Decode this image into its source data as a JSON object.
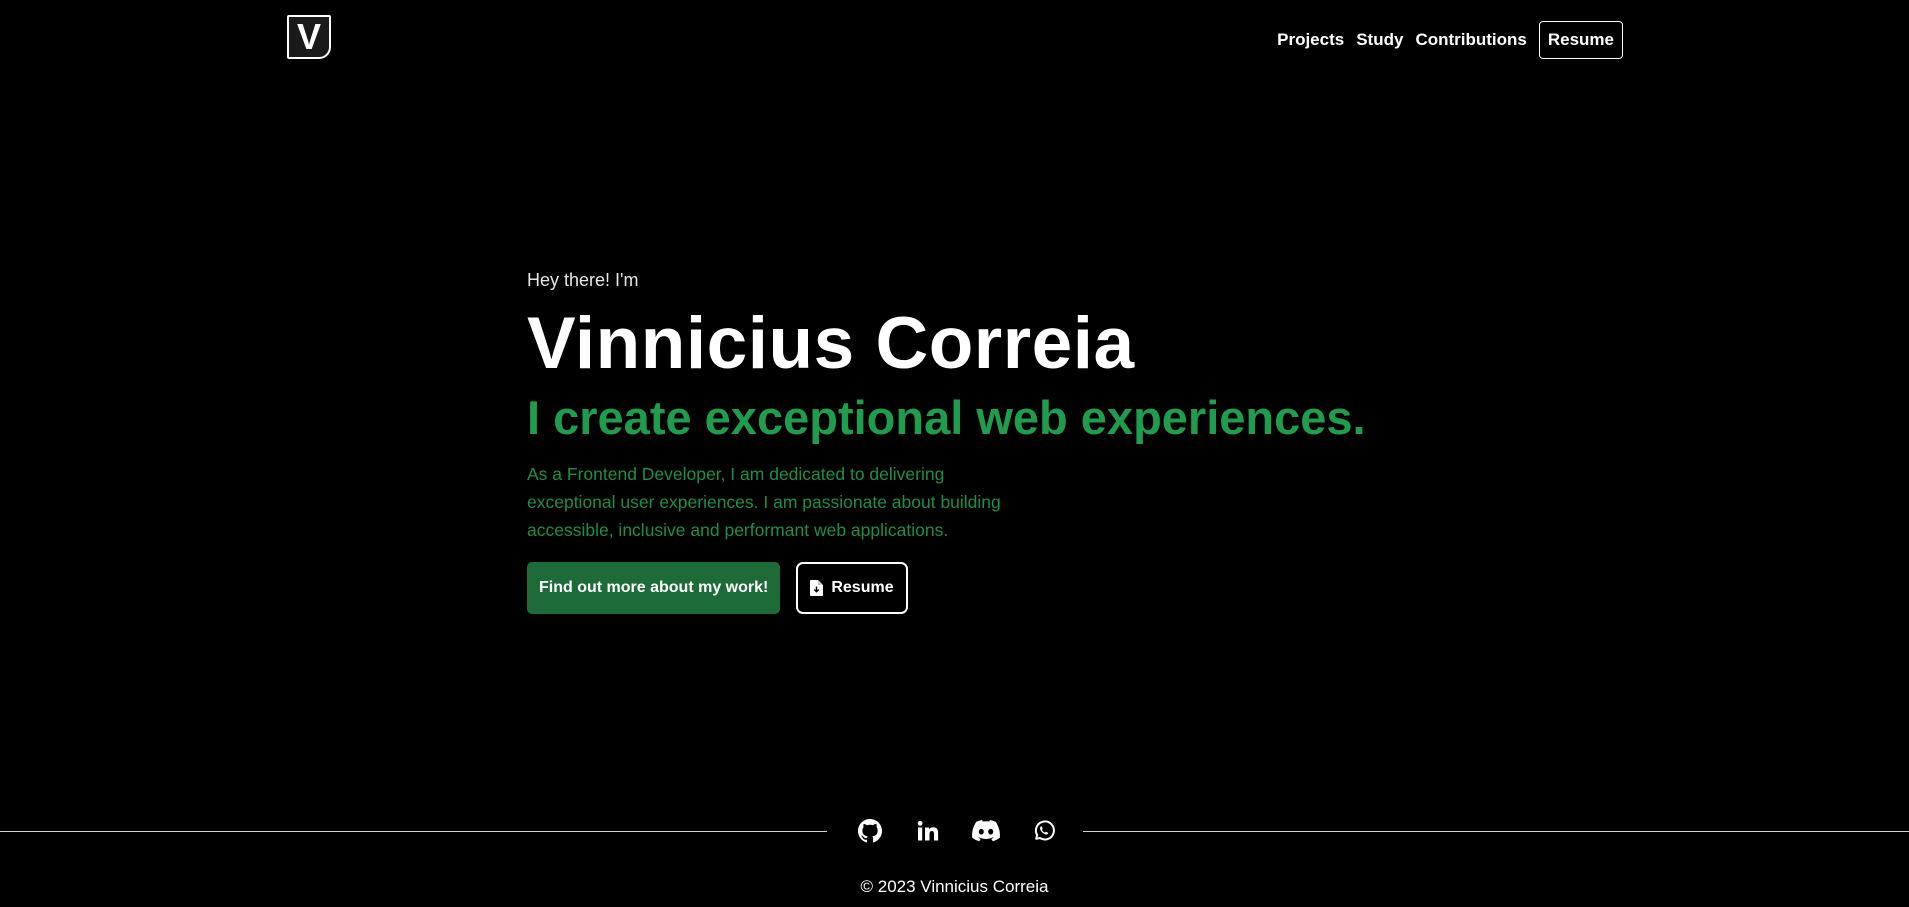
{
  "header": {
    "logo_letter": "V",
    "nav": [
      "Projects",
      "Study",
      "Contributions",
      "Resume"
    ]
  },
  "hero": {
    "greeting": "Hey there! I'm",
    "name": "Vinnicius Correia",
    "tagline": "I create exceptional web experiences.",
    "description": "As a Frontend Developer, I am dedicated to delivering exceptional user experiences. I am passionate about building accessible, inclusive and performant web applications.",
    "primary_button": "Find out more about my work!",
    "resume_button": "Resume"
  },
  "footer": {
    "social_icons": [
      "github-icon",
      "linkedin-icon",
      "discord-icon",
      "whatsapp-icon"
    ],
    "copyright": "© 2023 Vinnicius Correia"
  },
  "colors": {
    "background": "#000000",
    "accent_green": "#1f9c4e",
    "button_green": "#1c6b38",
    "text": "#ffffff"
  }
}
